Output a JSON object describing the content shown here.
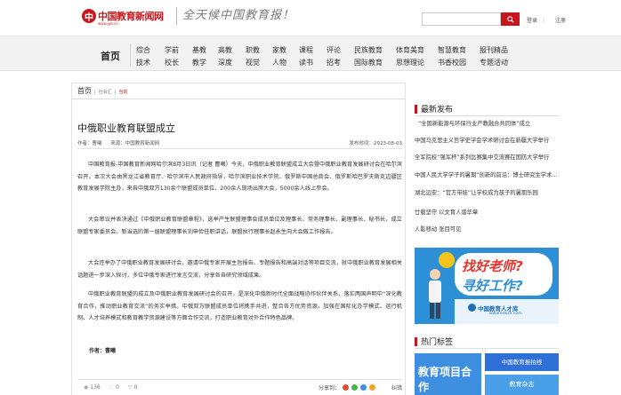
{
  "header": {
    "logo_mark": "中",
    "logo_text": "中国教育新闻网",
    "logo_url": "www.jyb.cn",
    "slogan": "全天候中国教育报！",
    "login": "登录",
    "register": "注册"
  },
  "nav": {
    "home": "首页",
    "columns": [
      {
        "top": "综合",
        "bottom": "技术"
      },
      {
        "top": "学前",
        "bottom": "校长"
      },
      {
        "top": "基教",
        "bottom": "教学"
      },
      {
        "top": "高教",
        "bottom": "深度"
      },
      {
        "top": "职教",
        "bottom": "视觉"
      },
      {
        "top": "家教",
        "bottom": "人物"
      },
      {
        "top": "课程",
        "bottom": "读书"
      },
      {
        "top": "评论",
        "bottom": "招考"
      },
      {
        "top": "民族教育",
        "bottom": "国际教育"
      },
      {
        "top": "体育美育",
        "bottom": "思想理论"
      },
      {
        "top": "智慧教育",
        "bottom": "书香校园"
      },
      {
        "top": "报刊精品",
        "bottom": "专题活动"
      }
    ]
  },
  "breadcrumb": {
    "home": "首页",
    "section": "社会汇",
    "current": "当前"
  },
  "article": {
    "title": "中俄职业教育联盟成立",
    "author_label": "作者：",
    "author": "曹曦",
    "source_label": "来源：",
    "source": "中国教育新闻网",
    "date": "发布时间：2023-08-03",
    "paragraphs": [
      "中国教育报-中国教育新闻网哈尔滨8月3日讯（记者 曹曦）今天，中俄职业教育联盟成立大会暨中俄职业教育发展研讨会在哈尔滨召开。本次大会由黑龙江省教育厅、哈尔滨市人民政府指导，哈尔滨职业技术学院、俄罗斯中国总商会、俄罗斯哈巴罗夫斯克边疆区教育发展学院主办，来自中俄双方130余个联盟成员单位、200余人现场出席大会，5000余人线上参会。",
      "大会审议并表决通过《中俄职业教育联盟章程》，选举产生联盟理事会成员单位及理事长、常务理事长、副理事长、秘书长，成立联盟专家委员会。新当选的第一届联盟理事长刘申俭任职讲话，联盟执行理事长赵永生向大会做工作报告。",
      "大会还举办了中俄职业教育发展研讨会，邀请中俄专家开展主旨报告、专题报告和高端对话等项目交流，就中俄职业教育发展相关话题进一步深入探讨，多位中俄专家进行发言交流，分享各自研究领域成果。",
      "中俄职业教育联盟的成立及中俄职业教育发展研讨会的召开，是深化中俄新时代全面战略协作伙伴关系，落实两国声明中“深化教育合作，推动职业教育交流”的务实举措。中俄双方联盟成员单位将携手共进，整合各方优势资源，加强在国际化办学模式、运行机制、人才培养模式和教育教学资源建设等方面合作交流，打造职业教育对外合作特色品牌。"
    ],
    "footer_author_label": "作者：",
    "footer_author": "曹曦"
  },
  "stats": {
    "views": "136",
    "likes": "0",
    "dislikes": "0"
  },
  "share": {
    "label": "分享到：",
    "print": "纠错"
  },
  "sidebar": {
    "latest_title": "最新发布",
    "latest": [
      "“全国新能源与环保行业产教融合共同体”成立",
      "中国马克思主义哲学史学会学术研讨会在新疆大学举行",
      "全军院校“强军杯”系列比赛集中交流赛在国防大学举行",
      "中国人民大学学子的暑期“创新的前沿：博士研究生学术论坛",
      "湖北远安：“官方带娃”让学校成为孩子的暑期乐园",
      "廿载坚守 以文育人谱华章",
      "人影移动 张目可见"
    ],
    "ad1": {
      "line1": "找好老师?",
      "line2": "寻好工作?",
      "brand": "中国教育人才库",
      "url": "www.educk.com"
    },
    "hot_title": "热门标签",
    "ad2": {
      "a": "教育项目合作",
      "b": "中国教育报拍线",
      "c": "教育杂志"
    }
  },
  "colors": {
    "brand_red": "#c8161d",
    "ad_blue": "#2d8fd6"
  }
}
